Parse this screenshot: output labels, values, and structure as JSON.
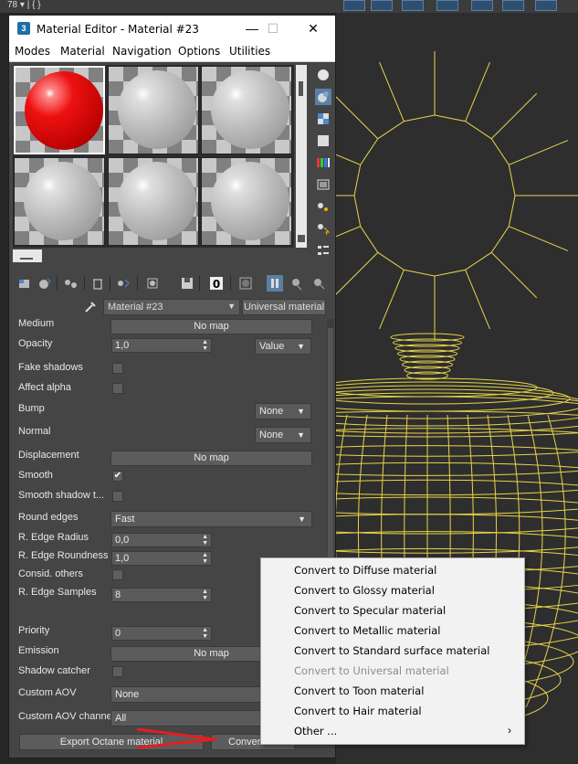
{
  "host": {
    "corner_glyph": "78 ▾  |  { }"
  },
  "window": {
    "title": "Material Editor - Material #23",
    "app_icon": "3",
    "minimize": "—",
    "maximize": "☐",
    "close": "✕"
  },
  "menu": [
    "Modes",
    "Material",
    "Navigation",
    "Options",
    "Utilities"
  ],
  "slots": [
    {
      "color": "red",
      "active": true
    },
    {
      "color": "gray",
      "active": false
    },
    {
      "color": "gray",
      "active": false
    },
    {
      "color": "gray",
      "active": false
    },
    {
      "color": "gray",
      "active": false
    },
    {
      "color": "gray",
      "active": false
    }
  ],
  "material": {
    "name": "Material #23",
    "type_button": "Universal material"
  },
  "params": {
    "medium": {
      "label": "Medium",
      "button": "No map"
    },
    "opacity": {
      "label": "Opacity",
      "value": "1,0",
      "mode": "Value"
    },
    "fake_shadows": {
      "label": "Fake shadows"
    },
    "affect_alpha": {
      "label": "Affect alpha"
    },
    "bump": {
      "label": "Bump",
      "value": "None"
    },
    "normal": {
      "label": "Normal",
      "value": "None"
    },
    "displacement": {
      "label": "Displacement",
      "button": "No map"
    },
    "smooth": {
      "label": "Smooth",
      "check": "✔"
    },
    "smooth_shadow": {
      "label": "Smooth shadow t..."
    },
    "round_edges": {
      "label": "Round edges",
      "value": "Fast"
    },
    "edge_radius": {
      "label": "R. Edge Radius",
      "value": "0,0"
    },
    "edge_roundness": {
      "label": "R. Edge Roundness",
      "value": "1,0"
    },
    "consid_others": {
      "label": "Consid. others"
    },
    "edge_samples": {
      "label": "R. Edge Samples",
      "value": "8"
    },
    "priority": {
      "label": "Priority",
      "value": "0"
    },
    "emission": {
      "label": "Emission",
      "button": "No map"
    },
    "shadow_catcher": {
      "label": "Shadow catcher"
    },
    "custom_aov": {
      "label": "Custom AOV",
      "value": "None"
    },
    "custom_aov_channel": {
      "label": "Custom AOV channel",
      "value": "All"
    }
  },
  "bottom": {
    "export": "Export Octane material",
    "convert": "Convert..."
  },
  "context_menu": {
    "items": [
      {
        "label": "Convert to Diffuse material",
        "enabled": true
      },
      {
        "label": "Convert to Glossy material",
        "enabled": true
      },
      {
        "label": "Convert to Specular material",
        "enabled": true
      },
      {
        "label": "Convert to Metallic material",
        "enabled": true
      },
      {
        "label": "Convert to Standard surface material",
        "enabled": true
      },
      {
        "label": "Convert to Universal material",
        "enabled": false
      },
      {
        "label": "Convert to Toon material",
        "enabled": true
      },
      {
        "label": "Convert to Hair material",
        "enabled": true
      },
      {
        "label": "Other ...",
        "enabled": true
      }
    ],
    "submenu_arrow": "›"
  },
  "colors": {
    "wire": "#e8d44a",
    "annotation": "#e02020",
    "panel": "#454545"
  }
}
